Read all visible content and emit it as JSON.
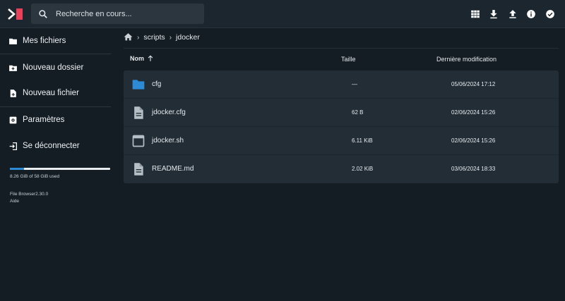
{
  "search": {
    "placeholder": "Recherche en cours..."
  },
  "header": {
    "actions": [
      {
        "icon": "grid-view-icon"
      },
      {
        "icon": "download-icon"
      },
      {
        "icon": "upload-icon"
      },
      {
        "icon": "info-icon"
      },
      {
        "icon": "select-check-icon"
      }
    ]
  },
  "sidebar": {
    "my_files": "Mes fichiers",
    "new_folder": "Nouveau dossier",
    "new_file": "Nouveau fichier",
    "settings": "Paramètres",
    "logout": "Se déconnecter",
    "usage_text": "8.26 GiB of 58 GiB used",
    "usage_fraction": 0.14,
    "version": "File Browser2.30.0",
    "help": "Aide"
  },
  "breadcrumb": {
    "items": [
      "scripts",
      "jdocker"
    ]
  },
  "listing": {
    "col_name": "Nom",
    "col_size": "Taille",
    "col_modified": "Dernière modification",
    "rows": [
      {
        "name": "cfg",
        "size": "—",
        "modified": "05/06/2024 17:12",
        "icon": "folder-icon"
      },
      {
        "name": "jdocker.cfg",
        "size": "62 B",
        "modified": "02/06/2024 15:26",
        "icon": "file-icon"
      },
      {
        "name": "jdocker.sh",
        "size": "6.11 KiB",
        "modified": "02/06/2024 15:26",
        "icon": "terminal-window-icon"
      },
      {
        "name": "README.md",
        "size": "2.02 KiB",
        "modified": "03/06/2024 18:33",
        "icon": "file-icon"
      }
    ]
  },
  "colors": {
    "background": "#141d24",
    "header": "#1b262e",
    "row": "#222d35",
    "folder": "#2d8bd6",
    "logo_accent": "#e8415a"
  }
}
